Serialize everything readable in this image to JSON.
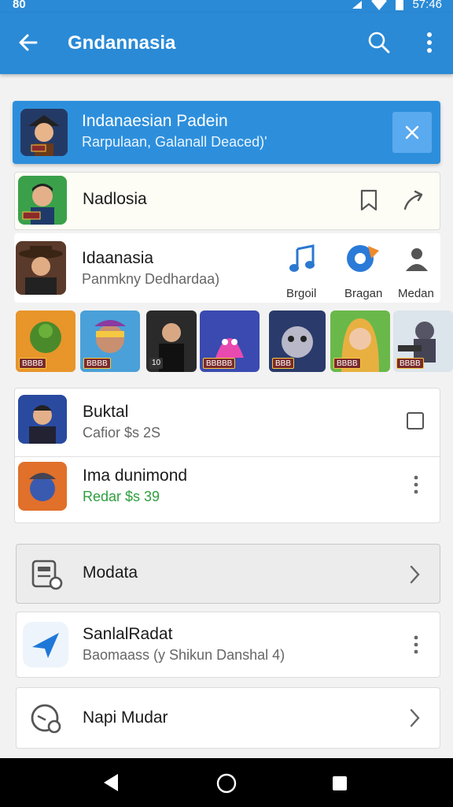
{
  "status_bar": {
    "left": "80",
    "time": "57:46"
  },
  "app_bar": {
    "title": "Gndannasia"
  },
  "banner": {
    "title": "Indanaesian Padein",
    "subtitle": "Rarpulaan, Galanall Deaced)'"
  },
  "card1": {
    "title": "Nadlosia"
  },
  "card2": {
    "title": "Idaanasia",
    "subtitle": "Panmkny Dedhardaa)",
    "actions": [
      {
        "label": "Brgoil",
        "icon": "music-note-icon"
      },
      {
        "label": "Bragan",
        "icon": "pie-chart-icon"
      },
      {
        "label": "Medan",
        "icon": "person-icon"
      }
    ]
  },
  "games": [
    {
      "badge": "BBBB",
      "icon": "turtle-game-icon"
    },
    {
      "badge": "BBBB",
      "icon": "hero-game-icon"
    },
    {
      "badge": "10",
      "icon": "samurai-game-icon"
    },
    {
      "badge": "BBBBB",
      "icon": "creature-game-icon"
    },
    {
      "badge": "BBB",
      "icon": "monster-game-icon"
    },
    {
      "badge": "BBBB",
      "icon": "girl-game-icon"
    },
    {
      "badge": "BBBB",
      "icon": "soldier-game-icon"
    }
  ],
  "list": [
    {
      "title": "Buktal",
      "subtitle": "Cafior $s 2S"
    },
    {
      "title": "Ima dunimond",
      "subtitle": "Redar $s 39"
    }
  ],
  "menu": [
    {
      "title": "Modata",
      "icon": "clipboard-gear-icon"
    },
    {
      "title": "SanlalRadat",
      "subtitle": "Baomaass (y Shikun Danshal 4)",
      "icon": "navigation-arrow-icon"
    },
    {
      "title": "Napi Mudar",
      "icon": "gauge-icon"
    }
  ],
  "colors": {
    "primary": "#2a8ad6",
    "banner": "#2d8fdc",
    "price_green": "#2e9e3e"
  }
}
